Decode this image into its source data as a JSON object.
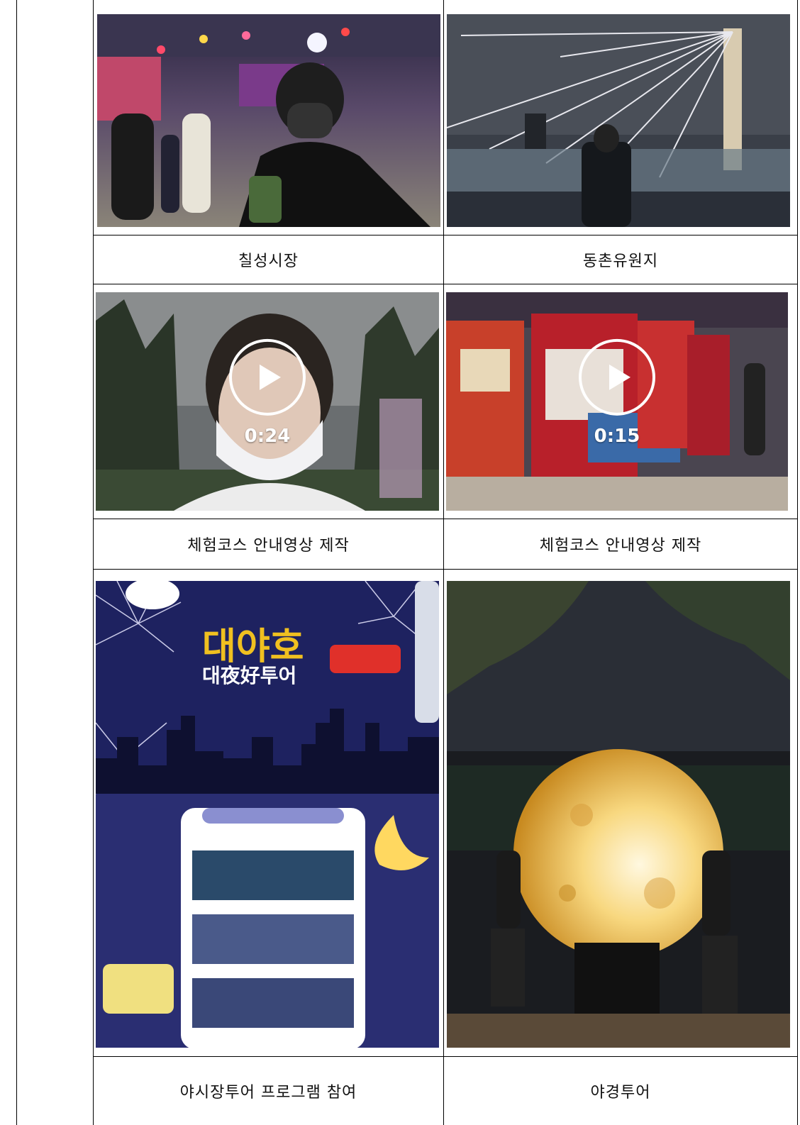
{
  "rows": [
    {
      "left_caption": "칠성시장",
      "right_caption": "동촌유원지"
    },
    {
      "left_caption": "체험코스 안내영상 제작",
      "right_caption": "체험코스 안내영상 제작",
      "left_duration": "0:24",
      "right_duration": "0:15"
    },
    {
      "left_caption": "야시장투어 프로그램 참여",
      "right_caption": "야경투어"
    }
  ],
  "poster": {
    "title_main": "대야호",
    "title_sub": "대夜好투어"
  },
  "icons": {
    "play": "play-icon"
  }
}
